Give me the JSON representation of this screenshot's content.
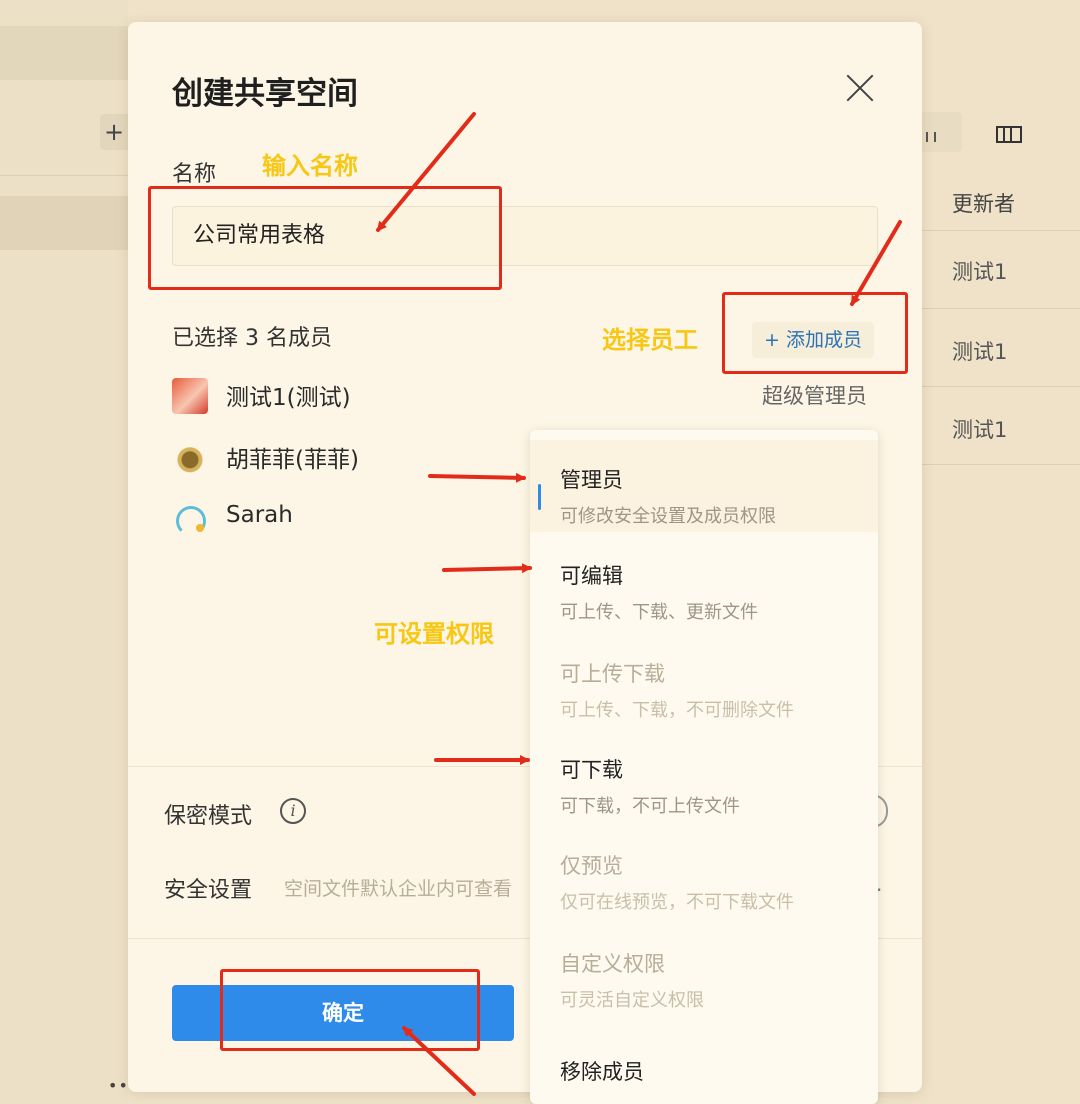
{
  "background": {
    "column_header": "更新者",
    "rows": [
      "测试1",
      "测试1",
      "测试1"
    ],
    "add_symbol": "+",
    "more_symbol": "•••"
  },
  "dialog": {
    "title": "创建共享空间",
    "name_label": "名称",
    "name_value": "公司常用表格",
    "members_count_text": "已选择 3 名成员",
    "add_member_label": "+ 添加成员",
    "members": [
      {
        "name": "测试1(测试)",
        "role": "超级管理员"
      },
      {
        "name": "胡菲菲(菲菲)"
      },
      {
        "name": "Sarah"
      }
    ],
    "confidential_label": "保密模式",
    "info_symbol": "i",
    "security_label": "安全设置",
    "security_desc": "空间文件默认企业内可查看",
    "security_more": "·",
    "confirm_label": "确定"
  },
  "permission_menu": {
    "options": [
      {
        "title": "管理员",
        "desc": "可修改安全设置及成员权限",
        "state": "selected"
      },
      {
        "title": "可编辑",
        "desc": "可上传、下载、更新文件",
        "state": "enabled"
      },
      {
        "title": "可上传下载",
        "desc": "可上传、下载，不可删除文件",
        "state": "disabled"
      },
      {
        "title": "可下载",
        "desc": "可下载，不可上传文件",
        "state": "enabled"
      },
      {
        "title": "仅预览",
        "desc": "仅可在线预览，不可下载文件",
        "state": "disabled"
      },
      {
        "title": "自定义权限",
        "desc": "可灵活自定义权限",
        "state": "disabled"
      }
    ],
    "remove_label": "移除成员"
  },
  "annotations": {
    "input_name": "输入名称",
    "select_staff": "选择员工",
    "set_permissions": "可设置权限",
    "highlight_color": "#e32b1a",
    "text_color": "#f7c713"
  },
  "colors": {
    "primary": "#2f8bea",
    "link": "#2b72b7",
    "background": "#efe2c8"
  }
}
